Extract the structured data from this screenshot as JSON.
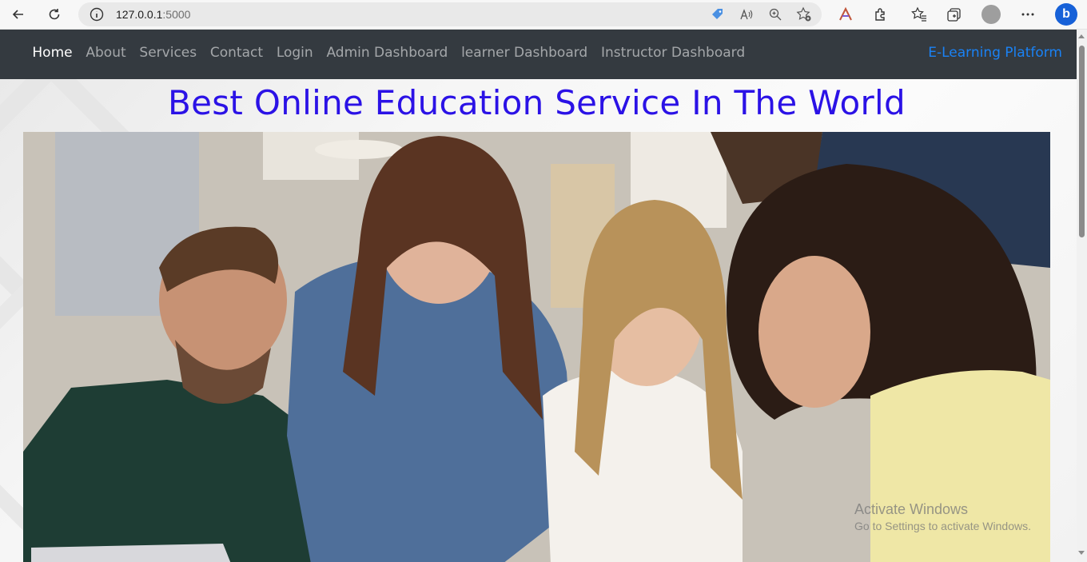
{
  "browser": {
    "url_host": "127.0.0.1",
    "url_port": ":5000"
  },
  "navbar": {
    "links": [
      {
        "label": "Home",
        "active": true
      },
      {
        "label": "About"
      },
      {
        "label": "Services"
      },
      {
        "label": "Contact"
      },
      {
        "label": "Login"
      },
      {
        "label": "Admin Dashboard"
      },
      {
        "label": "learner Dashboard"
      },
      {
        "label": "Instructor Dashboard"
      }
    ],
    "brand": "E-Learning Platform"
  },
  "main": {
    "headline": "Best Online Education Service In The World",
    "hero_image_icon": "students-group-photo-icon"
  },
  "watermark": {
    "title": "Activate Windows",
    "subtitle": "Go to Settings to activate Windows."
  },
  "colors": {
    "navbar_bg": "#343a40",
    "brand": "#1a82f5",
    "headline": "#2b12e6"
  }
}
